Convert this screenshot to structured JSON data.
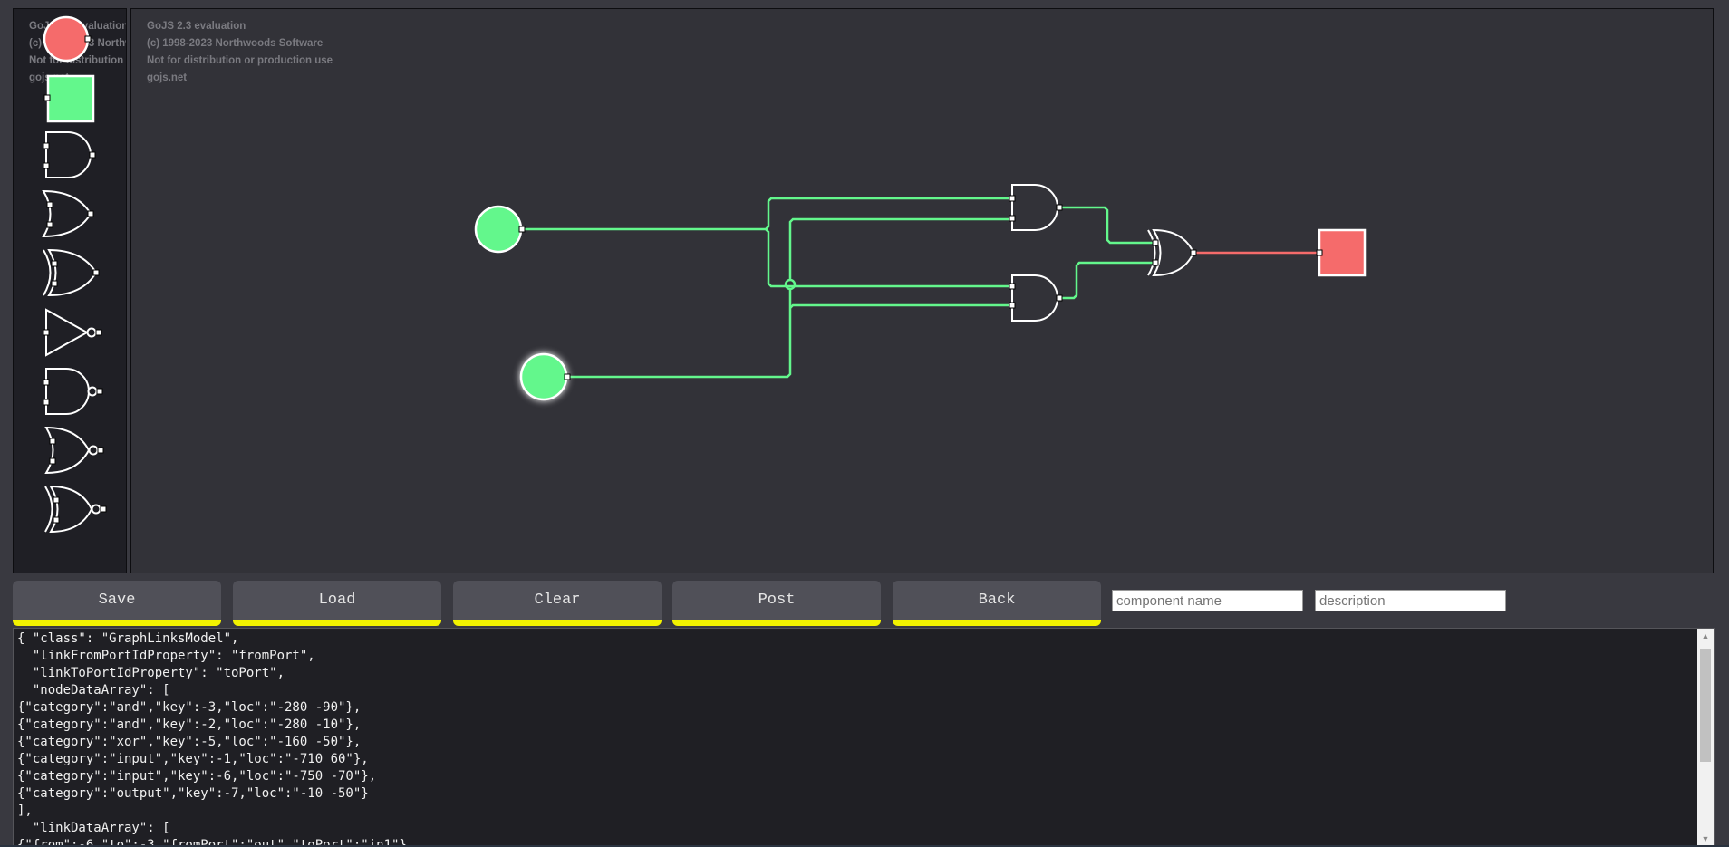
{
  "watermark": {
    "line1": "GoJS 2.3 evaluation",
    "line2": "(c) 1998-2023 Northwoods Software",
    "line3": "Not for distribution or production use",
    "line4": "gojs.net"
  },
  "palette": {
    "items": [
      "output",
      "input",
      "and",
      "or",
      "xor",
      "not",
      "nand",
      "nor",
      "xnor"
    ]
  },
  "colors": {
    "canvas_bg": "#323238",
    "palette_bg": "#1f1f25",
    "on_green": "#63f78c",
    "off_red": "#f56b6b",
    "button_accent": "#f2f200"
  },
  "toolbar": {
    "save_label": "Save",
    "load_label": "Load",
    "clear_label": "Clear",
    "post_label": "Post",
    "back_label": "Back",
    "component_name_placeholder": "component name",
    "description_placeholder": "description"
  },
  "model_json": "{ \"class\": \"GraphLinksModel\",\n  \"linkFromPortIdProperty\": \"fromPort\",\n  \"linkToPortIdProperty\": \"toPort\",\n  \"nodeDataArray\": [\n{\"category\":\"and\",\"key\":-3,\"loc\":\"-280 -90\"},\n{\"category\":\"and\",\"key\":-2,\"loc\":\"-280 -10\"},\n{\"category\":\"xor\",\"key\":-5,\"loc\":\"-160 -50\"},\n{\"category\":\"input\",\"key\":-1,\"loc\":\"-710 60\"},\n{\"category\":\"input\",\"key\":-6,\"loc\":\"-750 -70\"},\n{\"category\":\"output\",\"key\":-7,\"loc\":\"-10 -50\"}\n],\n  \"linkDataArray\": [\n{\"from\":-6,\"to\":-3,\"fromPort\":\"out\",\"toPort\":\"in1\"},"
}
